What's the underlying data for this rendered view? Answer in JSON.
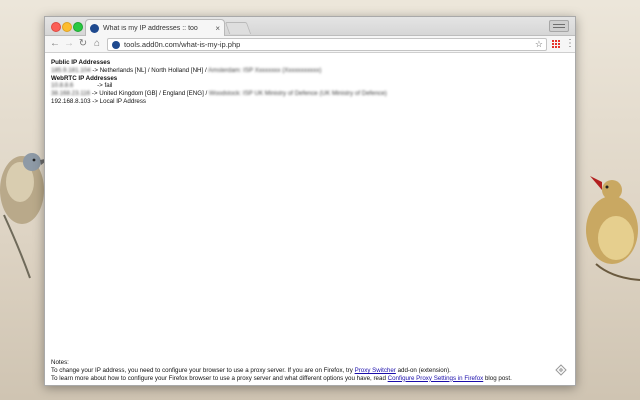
{
  "browser": {
    "tab_title": "What is my IP addresses :: too",
    "tab_close": "×",
    "url": "tools.add0n.com/what-is-my-ip.php",
    "icons": {
      "back": "arrow-left-icon",
      "forward": "arrow-right-icon",
      "reload": "reload-icon",
      "home": "home-icon",
      "bookmark": "star-icon",
      "extension": "grid-icon",
      "menu": "kebab-menu-icon"
    }
  },
  "page": {
    "public_heading": "Public IP Addresses",
    "public_line_1_ip": "185.9.181.104",
    "public_line_1_rest": "-> Netherlands [NL] / North Holland [NH] /",
    "public_line_1_blurred": "Amsterdam: ISP Xxxxxxxx (Xxxxxxxxxxx)",
    "webrtc_heading": "WebRTC IP Addresses",
    "webrtc_line_1_ip": "10.8.8.6",
    "webrtc_line_1_rest": "-> fail",
    "webrtc_line_2_ip": "38.168.23.116",
    "webrtc_line_2_rest": "-> United Kingdom [GB] / England [ENG] /",
    "webrtc_line_2_blurred": "Woodstock: ISP UK Ministry of Defence (UK Ministry of Defence)",
    "local_line": "192.168.8.103 -> Local IP Address"
  },
  "notes": {
    "title": "Notes:",
    "line1_pre": "To change your IP address, you need to configure your browser to use a proxy server. If you are on Firefox, try",
    "line1_link": "Proxy Switcher",
    "line1_post": "add-on (extension).",
    "line2_pre": "To learn more about how to configure your Firefox browser to use a proxy server and what different options you have, read",
    "line2_link": "Configure Proxy Settings in Firefox",
    "line2_post": "blog post."
  },
  "colors": {
    "link": "#1a0dab",
    "favicon": "#1f4a8f",
    "extension": "#e6332a"
  }
}
